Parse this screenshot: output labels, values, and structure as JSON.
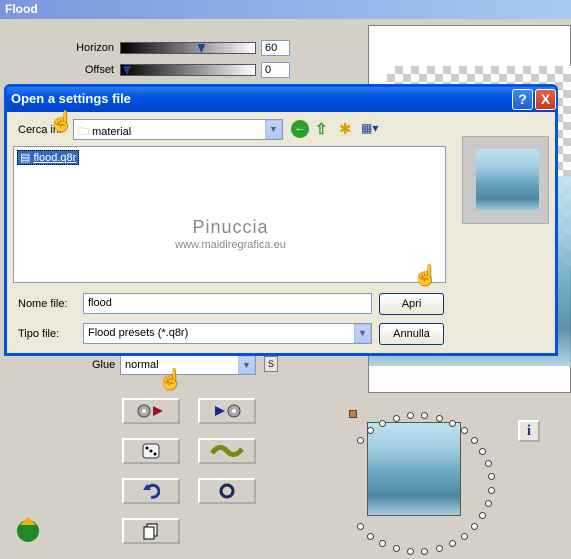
{
  "window": {
    "title": "Flood"
  },
  "sliders": [
    {
      "label": "Horizon",
      "value": "60",
      "level": 0.6
    },
    {
      "label": "Offset",
      "value": "0",
      "level": 0.0
    }
  ],
  "glue": {
    "label": "Glue",
    "value": "normal",
    "s_label": "S"
  },
  "dialog": {
    "title": "Open a settings file",
    "help_label": "?",
    "close_label": "X",
    "lookin_label": "Cerca in:",
    "lookin_value": "material",
    "file_item": "flood.q8r",
    "watermark_title": "Pinuccia",
    "watermark_url": "www.maidiregrafica.eu",
    "filename_label": "Nome file:",
    "filename_value": "flood",
    "filetype_label": "Tipo file:",
    "filetype_value": "Flood presets (*.q8r)",
    "open_label": "Apri",
    "cancel_label": "Annulla"
  },
  "info_label": "i"
}
